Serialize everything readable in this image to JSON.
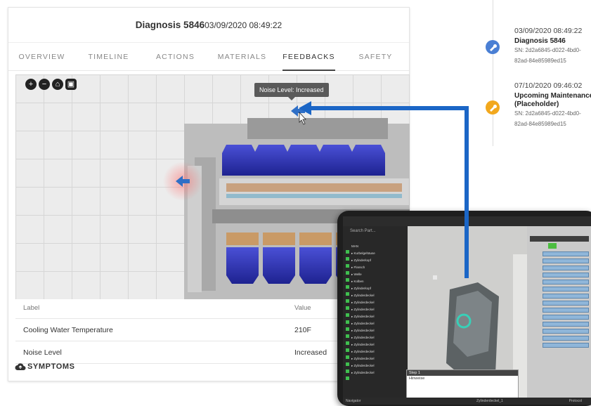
{
  "header": {
    "title": "Diagnosis 5846",
    "date": "03/09/2020 08:49:22"
  },
  "tabs": [
    {
      "label": "OVERVIEW"
    },
    {
      "label": "TIMELINE"
    },
    {
      "label": "ACTIONS"
    },
    {
      "label": "MATERIALS"
    },
    {
      "label": "FEEDBACKS"
    },
    {
      "label": "SAFETY"
    }
  ],
  "viewer": {
    "tooltip": "Noise Level: Increased",
    "controls": {
      "zoom_in": "+",
      "zoom_out": "−",
      "home": "⌂",
      "save": "▣"
    }
  },
  "table": {
    "headers": {
      "label": "Label",
      "value": "Value"
    },
    "rows": [
      {
        "label": "Cooling Water Temperature",
        "value": "210F"
      },
      {
        "label": "Noise Level",
        "value": "Increased"
      }
    ]
  },
  "symptoms_label": "SYMPTOMS",
  "timeline": [
    {
      "date": "03/09/2020 08:49:22",
      "title": "Diagnosis 5846",
      "sn1": "SN: 2d2a6845-d022-4bd0-",
      "sn2": "82ad-84e85989ed15"
    },
    {
      "date": "07/10/2020 09:46:02",
      "title": "Upcoming Maintenance",
      "title2": "(Placeholder)",
      "sn1": "SN: 2d2a6845-d022-4bd0-",
      "sn2": "82ad-84e85989ed15"
    }
  ],
  "tablet": {
    "search_placeholder": "Search Part...",
    "step_title": "Step 1",
    "step_row": "Hinweise",
    "bottom_left": "Navigator",
    "bottom_mid": "Zylinderdeckel_1",
    "bottom_right": "Protocol"
  },
  "colors": {
    "accent_blue": "#1b66c6",
    "dot_blue": "#4a7fd4",
    "dot_orange": "#f2a81d",
    "machine_blue": "#2a2fa8"
  }
}
